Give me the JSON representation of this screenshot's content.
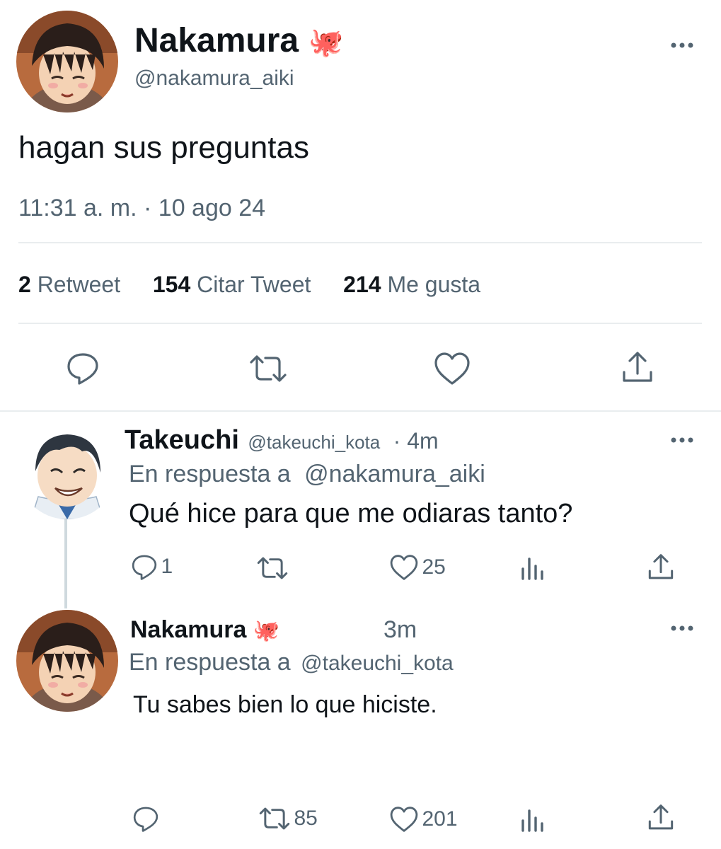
{
  "main_tweet": {
    "display_name": "Nakamura",
    "name_emoji": "🐙",
    "handle": "@nakamura_aiki",
    "text": "hagan sus preguntas",
    "timestamp": "11:31 a. m. · 10 ago 24",
    "stats": {
      "retweets_count": "2",
      "retweets_label": "Retweet",
      "quotes_count": "154",
      "quotes_label": "Citar Tweet",
      "likes_count": "214",
      "likes_label": "Me gusta"
    },
    "more_icon": "more-icon",
    "actions": [
      "reply-icon",
      "retweet-icon",
      "like-icon",
      "share-icon"
    ]
  },
  "reply1": {
    "display_name": "Takeuchi",
    "handle": "@takeuchi_kota",
    "time": "· 4m",
    "reply_prefix": "En respuesta a",
    "reply_to": "@nakamura_aiki",
    "text": "Qué hice para que me odiaras tanto?",
    "reply_count": "1",
    "retweet_count": "",
    "like_count": "25"
  },
  "reply2": {
    "display_name": "Nakamura",
    "name_emoji": "🐙",
    "time": "3m",
    "reply_prefix": "En respuesta a",
    "reply_to": "@takeuchi_kota",
    "text": "Tu sabes bien lo que hiciste.",
    "reply_count": "",
    "retweet_count": "85",
    "like_count": "201"
  },
  "colors": {
    "text": "#0f1419",
    "muted": "#536471",
    "divider": "#e9edef",
    "thread_line": "#cfd9de"
  }
}
